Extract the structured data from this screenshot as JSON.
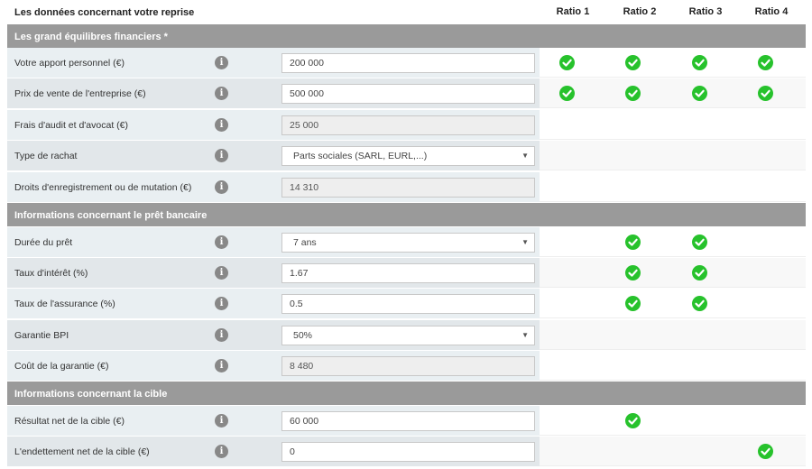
{
  "header": {
    "title": "Les données concernant votre reprise",
    "ratios": [
      "Ratio 1",
      "Ratio 2",
      "Ratio 3",
      "Ratio 4"
    ]
  },
  "colors": {
    "section_bg": "#9a9a9a",
    "check_green": "#27c22c",
    "info_icon": "#888888"
  },
  "sections": [
    {
      "title": "Les grand équilibres financiers *",
      "rows": [
        {
          "label": "Votre apport personnel (€)",
          "value": "200 000",
          "kind": "input",
          "checks": [
            1,
            1,
            1,
            1
          ]
        },
        {
          "label": "Prix de vente de l'entreprise (€)",
          "value": "500 000",
          "kind": "input",
          "checks": [
            1,
            1,
            1,
            1
          ]
        },
        {
          "label": "Frais d'audit et d'avocat (€)",
          "value": "25 000",
          "kind": "readonly",
          "checks": [
            0,
            0,
            0,
            0
          ]
        },
        {
          "label": "Type de rachat",
          "value": "Parts sociales (SARL, EURL,...)",
          "kind": "select",
          "checks": [
            0,
            0,
            0,
            0
          ]
        },
        {
          "label": "Droits d'enregistrement ou de mutation (€)",
          "value": "14 310",
          "kind": "readonly",
          "checks": [
            0,
            0,
            0,
            0
          ]
        }
      ]
    },
    {
      "title": "Informations concernant le prêt bancaire",
      "rows": [
        {
          "label": "Durée du prêt",
          "value": "7 ans",
          "kind": "select",
          "checks": [
            0,
            1,
            1,
            0
          ]
        },
        {
          "label": "Taux d'intérêt (%)",
          "value": "1.67",
          "kind": "input",
          "checks": [
            0,
            1,
            1,
            0
          ]
        },
        {
          "label": "Taux de l'assurance (%)",
          "value": "0.5",
          "kind": "input",
          "checks": [
            0,
            1,
            1,
            0
          ]
        },
        {
          "label": "Garantie BPI",
          "value": "50%",
          "kind": "select",
          "checks": [
            0,
            0,
            0,
            0
          ]
        },
        {
          "label": "Coût de la garantie (€)",
          "value": "8 480",
          "kind": "readonly",
          "checks": [
            0,
            0,
            0,
            0
          ]
        }
      ]
    },
    {
      "title": "Informations concernant la cible",
      "rows": [
        {
          "label": "Résultat net de la cible (€)",
          "value": "60 000",
          "kind": "input",
          "checks": [
            0,
            1,
            0,
            0
          ]
        },
        {
          "label": "L'endettement net de la cible (€)",
          "value": "0",
          "kind": "input",
          "checks": [
            0,
            0,
            0,
            1
          ]
        }
      ]
    }
  ],
  "icons": {
    "info": "info-icon",
    "check": "check-circle-icon",
    "caret": "chevron-down-icon"
  }
}
